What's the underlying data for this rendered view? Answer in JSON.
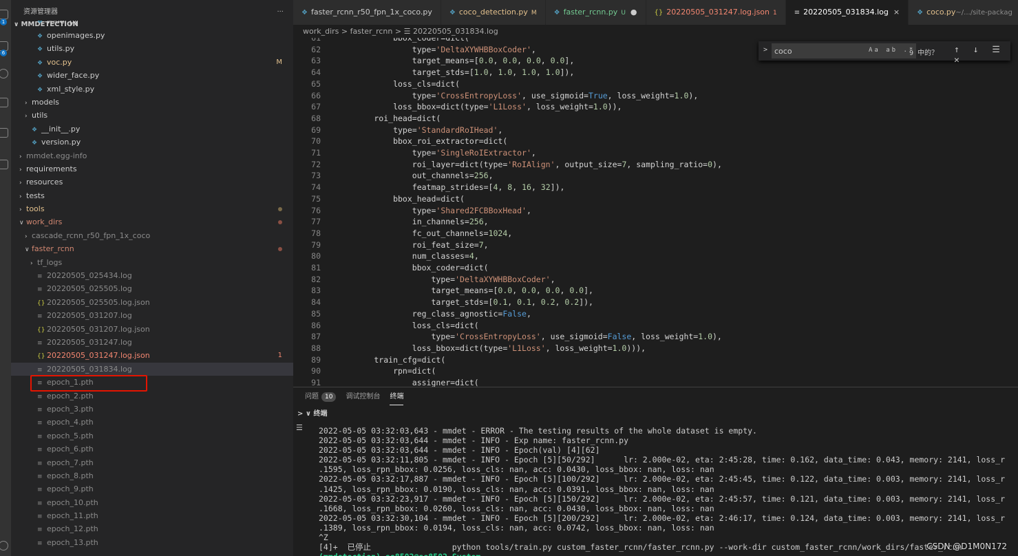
{
  "sidebar": {
    "title": "资源管理器",
    "more": "···",
    "section": "MMDETECTION",
    "items": [
      {
        "label": "wider.py",
        "depth": 3,
        "kind": "py",
        "color": "#cccccc"
      },
      {
        "label": "openimages.py",
        "depth": 3,
        "kind": "py",
        "color": "#cccccc"
      },
      {
        "label": "utils.py",
        "depth": 3,
        "kind": "py",
        "color": "#cccccc"
      },
      {
        "label": "voc.py",
        "depth": 3,
        "kind": "py",
        "color": "#e2c08d",
        "decoration": "M",
        "deco_color": "#e2c08d"
      },
      {
        "label": "wider_face.py",
        "depth": 3,
        "kind": "py",
        "color": "#cccccc"
      },
      {
        "label": "xml_style.py",
        "depth": 3,
        "kind": "py",
        "color": "#cccccc"
      },
      {
        "label": "models",
        "depth": 2,
        "kind": "folder",
        "color": "#cccccc"
      },
      {
        "label": "utils",
        "depth": 2,
        "kind": "folder",
        "color": "#cccccc"
      },
      {
        "label": "__init__.py",
        "depth": 2,
        "kind": "py",
        "color": "#cccccc"
      },
      {
        "label": "version.py",
        "depth": 2,
        "kind": "py",
        "color": "#cccccc"
      },
      {
        "label": "mmdet.egg-info",
        "depth": 1,
        "kind": "folder",
        "color": "#8b8b8b"
      },
      {
        "label": "requirements",
        "depth": 1,
        "kind": "folder",
        "color": "#cccccc"
      },
      {
        "label": "resources",
        "depth": 1,
        "kind": "folder",
        "color": "#cccccc"
      },
      {
        "label": "tests",
        "depth": 1,
        "kind": "folder",
        "color": "#cccccc"
      },
      {
        "label": "tools",
        "depth": 1,
        "kind": "folder",
        "color": "#e2c08d",
        "dot": "#7a6a48"
      },
      {
        "label": "work_dirs",
        "depth": 1,
        "kind": "folder-open",
        "color": "#d18771",
        "dot": "#8a4f43"
      },
      {
        "label": "cascade_rcnn_r50_fpn_1x_coco",
        "depth": 2,
        "kind": "folder",
        "color": "#8b8b8b"
      },
      {
        "label": "faster_rcnn",
        "depth": 2,
        "kind": "folder-open",
        "color": "#d18771",
        "dot": "#8a4f43"
      },
      {
        "label": "tf_logs",
        "depth": 3,
        "kind": "folder",
        "color": "#8b8b8b"
      },
      {
        "label": "20220505_025434.log",
        "depth": 3,
        "kind": "log",
        "color": "#8b8b8b"
      },
      {
        "label": "20220505_025505.log",
        "depth": 3,
        "kind": "log",
        "color": "#8b8b8b"
      },
      {
        "label": "20220505_025505.log.json",
        "depth": 3,
        "kind": "json",
        "color": "#8b8b8b"
      },
      {
        "label": "20220505_031207.log",
        "depth": 3,
        "kind": "log",
        "color": "#8b8b8b"
      },
      {
        "label": "20220505_031207.log.json",
        "depth": 3,
        "kind": "json",
        "color": "#8b8b8b"
      },
      {
        "label": "20220505_031247.log",
        "depth": 3,
        "kind": "log",
        "color": "#8b8b8b"
      },
      {
        "label": "20220505_031247.log.json",
        "depth": 3,
        "kind": "json",
        "color": "#f48771",
        "decoration": "1",
        "deco_color": "#f48771"
      },
      {
        "label": "20220505_031834.log",
        "depth": 3,
        "kind": "log",
        "color": "#8b8b8b",
        "selected": true
      },
      {
        "label": "epoch_1.pth",
        "depth": 3,
        "kind": "log",
        "color": "#8b8b8b"
      },
      {
        "label": "epoch_2.pth",
        "depth": 3,
        "kind": "log",
        "color": "#8b8b8b"
      },
      {
        "label": "epoch_3.pth",
        "depth": 3,
        "kind": "log",
        "color": "#8b8b8b"
      },
      {
        "label": "epoch_4.pth",
        "depth": 3,
        "kind": "log",
        "color": "#8b8b8b"
      },
      {
        "label": "epoch_5.pth",
        "depth": 3,
        "kind": "log",
        "color": "#8b8b8b"
      },
      {
        "label": "epoch_6.pth",
        "depth": 3,
        "kind": "log",
        "color": "#8b8b8b"
      },
      {
        "label": "epoch_7.pth",
        "depth": 3,
        "kind": "log",
        "color": "#8b8b8b"
      },
      {
        "label": "epoch_8.pth",
        "depth": 3,
        "kind": "log",
        "color": "#8b8b8b"
      },
      {
        "label": "epoch_9.pth",
        "depth": 3,
        "kind": "log",
        "color": "#8b8b8b"
      },
      {
        "label": "epoch_10.pth",
        "depth": 3,
        "kind": "log",
        "color": "#8b8b8b"
      },
      {
        "label": "epoch_11.pth",
        "depth": 3,
        "kind": "log",
        "color": "#8b8b8b"
      },
      {
        "label": "epoch_12.pth",
        "depth": 3,
        "kind": "log",
        "color": "#8b8b8b"
      },
      {
        "label": "epoch_13.pth",
        "depth": 3,
        "kind": "log",
        "color": "#8b8b8b"
      }
    ]
  },
  "activity_badges": [
    "1",
    "6"
  ],
  "tabs": [
    {
      "label": "faster_rcnn_r50_fpn_1x_coco.py",
      "icon": "python-icon",
      "color": "#cccccc"
    },
    {
      "label": "coco_detection.py",
      "decoration": "M",
      "icon": "python-icon",
      "color": "#e2c08d"
    },
    {
      "label": "faster_rcnn.py",
      "decoration": "U",
      "icon": "python-icon",
      "color": "#73c991",
      "dirty": "●"
    },
    {
      "label": "20220505_031247.log.json",
      "decoration": "1",
      "icon": "json-icon",
      "color": "#f48771"
    },
    {
      "label": "20220505_031834.log",
      "icon": "log-icon",
      "color": "#ffffff",
      "active": true,
      "close": "×"
    },
    {
      "label": "coco.py",
      "suffix": "~/.../site-packag",
      "icon": "python-icon",
      "color": "#e2c08d"
    }
  ],
  "breadcrumb": {
    "folder1": "work_dirs",
    "folder2": "faster_rcnn",
    "file": "20220505_031834.log",
    "sep": ">"
  },
  "find": {
    "value": "coco",
    "options": "Aa ab .*",
    "count": "9 中的？",
    "buttons": "↑ ↓ ☰ ✕",
    "arrow": ">"
  },
  "editor": {
    "lines": [
      {
        "n": "61",
        "t": "            bbox_coder=dict("
      },
      {
        "n": "62",
        "t": "                type='DeltaXYWHBBoxCoder',"
      },
      {
        "n": "63",
        "t": "                target_means=[0.0, 0.0, 0.0, 0.0],"
      },
      {
        "n": "64",
        "t": "                target_stds=[1.0, 1.0, 1.0, 1.0]),"
      },
      {
        "n": "65",
        "t": "            loss_cls=dict("
      },
      {
        "n": "66",
        "t": "                type='CrossEntropyLoss', use_sigmoid=True, loss_weight=1.0),"
      },
      {
        "n": "67",
        "t": "            loss_bbox=dict(type='L1Loss', loss_weight=1.0)),"
      },
      {
        "n": "68",
        "t": "        roi_head=dict("
      },
      {
        "n": "69",
        "t": "            type='StandardRoIHead',"
      },
      {
        "n": "70",
        "t": "            bbox_roi_extractor=dict("
      },
      {
        "n": "71",
        "t": "                type='SingleRoIExtractor',"
      },
      {
        "n": "72",
        "t": "                roi_layer=dict(type='RoIAlign', output_size=7, sampling_ratio=0),"
      },
      {
        "n": "73",
        "t": "                out_channels=256,"
      },
      {
        "n": "74",
        "t": "                featmap_strides=[4, 8, 16, 32]),"
      },
      {
        "n": "75",
        "t": "            bbox_head=dict("
      },
      {
        "n": "76",
        "t": "                type='Shared2FCBBoxHead',"
      },
      {
        "n": "77",
        "t": "                in_channels=256,"
      },
      {
        "n": "78",
        "t": "                fc_out_channels=1024,"
      },
      {
        "n": "79",
        "t": "                roi_feat_size=7,"
      },
      {
        "n": "80",
        "t": "                num_classes=4,"
      },
      {
        "n": "81",
        "t": "                bbox_coder=dict("
      },
      {
        "n": "82",
        "t": "                    type='DeltaXYWHBBoxCoder',"
      },
      {
        "n": "83",
        "t": "                    target_means=[0.0, 0.0, 0.0, 0.0],"
      },
      {
        "n": "84",
        "t": "                    target_stds=[0.1, 0.1, 0.2, 0.2]),"
      },
      {
        "n": "85",
        "t": "                reg_class_agnostic=False,"
      },
      {
        "n": "86",
        "t": "                loss_cls=dict("
      },
      {
        "n": "87",
        "t": "                    type='CrossEntropyLoss', use_sigmoid=False, loss_weight=1.0),"
      },
      {
        "n": "88",
        "t": "                loss_bbox=dict(type='L1Loss', loss_weight=1.0))),"
      },
      {
        "n": "89",
        "t": "        train_cfg=dict("
      },
      {
        "n": "90",
        "t": "            rpn=dict("
      },
      {
        "n": "91",
        "t": "                assigner=dict("
      }
    ]
  },
  "panel": {
    "tabs": [
      {
        "label": "问题",
        "badge": "10"
      },
      {
        "label": "调试控制台"
      },
      {
        "label": "终端",
        "active": true
      }
    ],
    "section": "终端",
    "section_arrow": "∨",
    "outer_arrow": ">",
    "list_icon": "☰",
    "terminal_lines": [
      "2022-05-05 03:32:03,643 - mmdet - ERROR - The testing results of the whole dataset is empty.",
      "2022-05-05 03:32:03,644 - mmdet - INFO - Exp name: faster_rcnn.py",
      "2022-05-05 03:32:03,644 - mmdet - INFO - Epoch(val) [4][62]",
      "2022-05-05 03:32:11,805 - mmdet - INFO - Epoch [5][50/292]      lr: 2.000e-02, eta: 2:45:28, time: 0.162, data_time: 0.043, memory: 2141, loss_r",
      ".1595, loss_rpn_bbox: 0.0256, loss_cls: nan, acc: 0.0430, loss_bbox: nan, loss: nan",
      "2022-05-05 03:32:17,887 - mmdet - INFO - Epoch [5][100/292]     lr: 2.000e-02, eta: 2:45:45, time: 0.122, data_time: 0.003, memory: 2141, loss_r",
      ".1425, loss_rpn_bbox: 0.0190, loss_cls: nan, acc: 0.0391, loss_bbox: nan, loss: nan",
      "2022-05-05 03:32:23,917 - mmdet - INFO - Epoch [5][150/292]     lr: 2.000e-02, eta: 2:45:57, time: 0.121, data_time: 0.003, memory: 2141, loss_r",
      ".1668, loss_rpn_bbox: 0.0260, loss_cls: nan, acc: 0.0430, loss_bbox: nan, loss: nan",
      "2022-05-05 03:32:30,104 - mmdet - INFO - Epoch [5][200/292]     lr: 2.000e-02, eta: 2:46:17, time: 0.124, data_time: 0.003, memory: 2141, loss_r",
      ".1389, loss_rpn_bbox: 0.0194, loss_cls: nan, acc: 0.0742, loss_bbox: nan, loss: nan",
      "^Z",
      "[4]+  已停止                 python tools/train.py custom_faster_rcnn/faster_rcnn.py --work-dir custom_faster_rcnn/work_dirs/faster_rcnn",
      "(mmdetection) se8502@se8502-System"
    ]
  },
  "watermark": "CSDN @D1M0N172"
}
